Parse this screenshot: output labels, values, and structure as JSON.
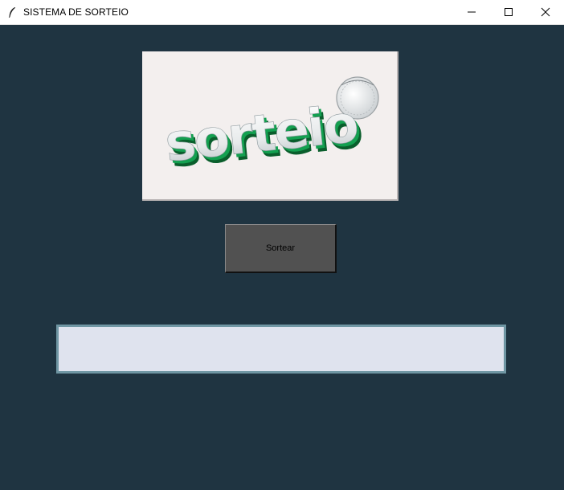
{
  "window": {
    "title": "SISTEMA DE SORTEIO",
    "controls": {
      "minimize_icon": "minimize-icon",
      "maximize_icon": "maximize-icon",
      "close_icon": "close-icon"
    }
  },
  "logo": {
    "text": "sorteio",
    "icon": "lottery-ball-icon"
  },
  "main": {
    "draw_button_label": "Sortear",
    "result_value": ""
  },
  "colors": {
    "background": "#1f3441",
    "button": "#515151",
    "result_field": "#dfe3ee",
    "result_border": "#6f96a3",
    "logo_green": "#0f8f44"
  }
}
